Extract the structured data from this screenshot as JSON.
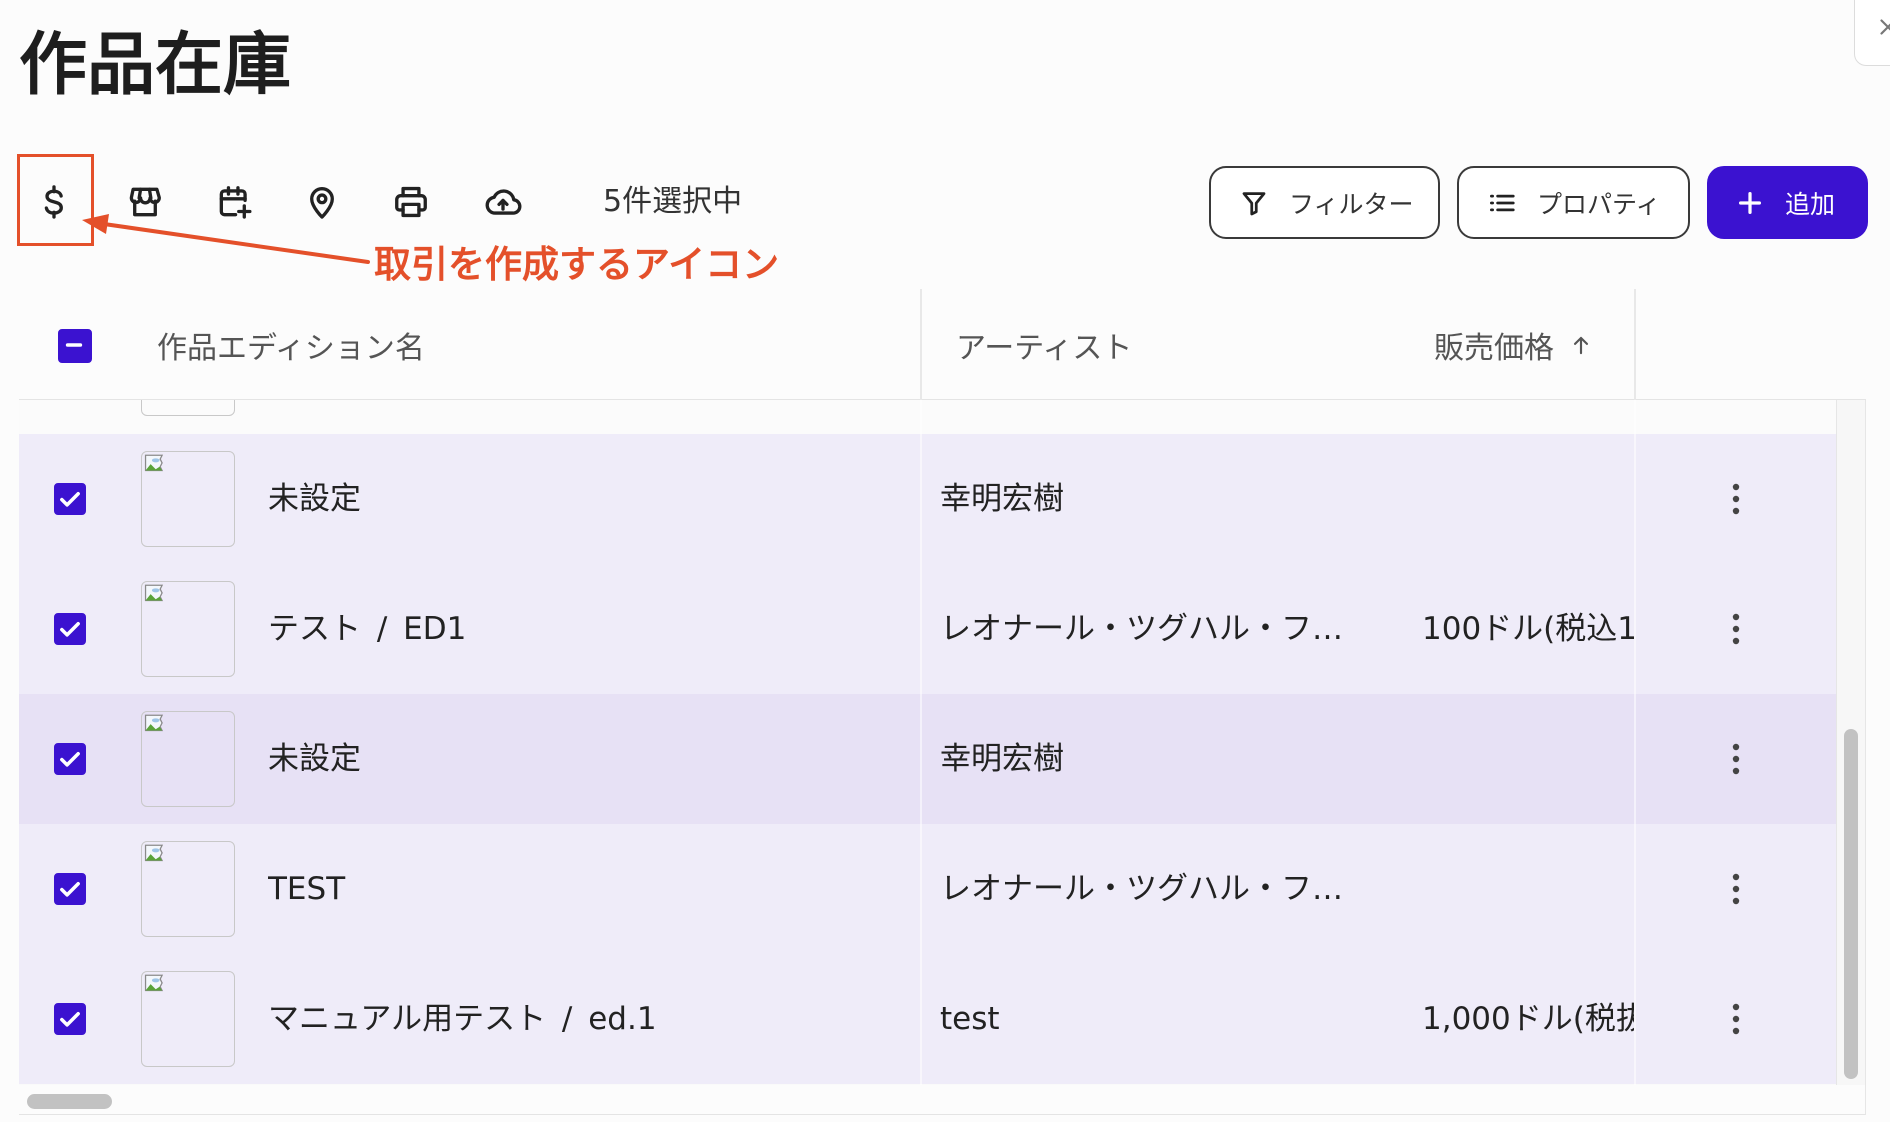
{
  "page": {
    "title": "作品在庫"
  },
  "toolbar": {
    "icons": [
      "dollar-icon",
      "store-icon",
      "calendar-add-icon",
      "location-pin-icon",
      "printer-icon",
      "cloud-upload-icon"
    ],
    "selection_count": "5件選択中",
    "filter": {
      "label": "フィルター",
      "icon": "filter-icon"
    },
    "properties": {
      "label": "プロパティ",
      "icon": "list-icon"
    },
    "add": {
      "label": "追加",
      "icon": "plus-icon"
    }
  },
  "annotation": {
    "text": "取引を作成するアイコン"
  },
  "table": {
    "select_all_indeterminate": true,
    "columns": [
      {
        "label": "作品エディション名"
      },
      {
        "label": "アーティスト"
      },
      {
        "label": "販売価格",
        "sort_ascending": true
      }
    ],
    "rows": [
      {
        "name": "未設定",
        "artist": "幸明宏樹",
        "price": "",
        "selected": true
      },
      {
        "name": "テスト / ED1",
        "artist": "レオナール・ツグハル・フ…",
        "price": "100ドル(税込1",
        "selected": true
      },
      {
        "name": "未設定",
        "artist": "幸明宏樹",
        "price": "",
        "selected": true,
        "highlighted": true
      },
      {
        "name": "TEST",
        "artist": "レオナール・ツグハル・フ…",
        "price": "",
        "selected": true
      },
      {
        "name": "マニュアル用テスト / ed.1",
        "artist": "test",
        "price": "1,000ドル(税抜",
        "selected": true
      }
    ]
  },
  "colors": {
    "accent": "#3b12d0",
    "annotation": "#e4502a",
    "row_selected": "#efecf9",
    "row_highlighted": "#e7e1f5"
  }
}
